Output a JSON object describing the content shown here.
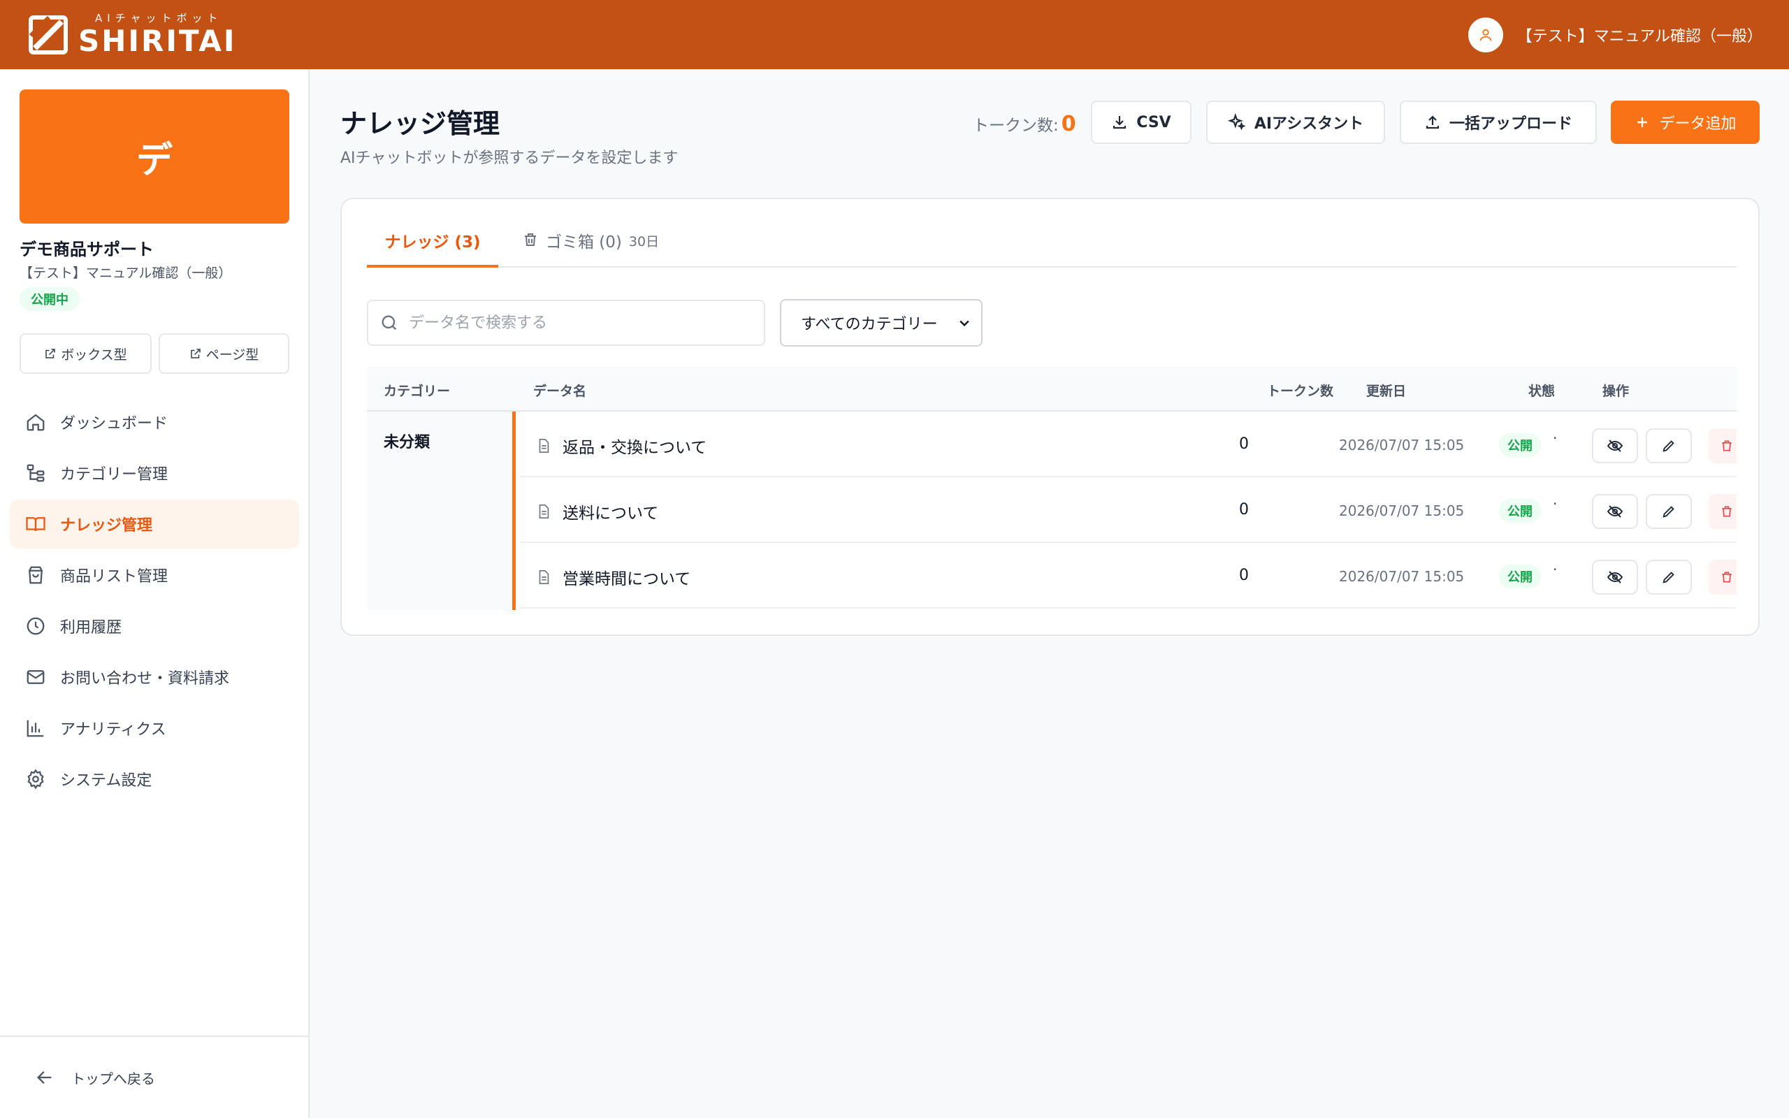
{
  "header": {
    "logo_sub": "AIチャットボット",
    "logo_main": "SHIRITAI",
    "user_name": "【テスト】マニュアル確認（一般）"
  },
  "sidebar": {
    "brand_initial": "デ",
    "brand_name": "デモ商品サポート",
    "brand_owner": "【テスト】マニュアル確認（一般）",
    "status": "公開中",
    "box_link": "ボックス型",
    "page_link": "ページ型",
    "items": [
      {
        "label": "ダッシュボード",
        "icon": "home-icon"
      },
      {
        "label": "カテゴリー管理",
        "icon": "category-tree-icon"
      },
      {
        "label": "ナレッジ管理",
        "icon": "book-icon",
        "active": true
      },
      {
        "label": "商品リスト管理",
        "icon": "shopping-bag-icon"
      },
      {
        "label": "利用履歴",
        "icon": "clock-icon"
      },
      {
        "label": "お問い合わせ・資料請求",
        "icon": "mail-icon"
      },
      {
        "label": "アナリティクス",
        "icon": "bar-chart-icon"
      },
      {
        "label": "システム設定",
        "icon": "gear-icon"
      }
    ],
    "back_label": "トップへ戻る"
  },
  "main": {
    "title": "ナレッジ管理",
    "subtitle": "AIチャットボットが参照するデータを設定します",
    "token_label": "トークン数:",
    "token_value": "0",
    "csv_label": "CSV",
    "assistant_label": "AIアシスタント",
    "bulk_upload_label": "一括アップロード",
    "add_label": "データ追加",
    "tabs": {
      "knowledge": "ナレッジ (3)",
      "trash": "ゴミ箱 (0)",
      "trash_note": "30日"
    },
    "search_placeholder": "データ名で検索する",
    "category_filter": "すべてのカテゴリー",
    "columns": {
      "category": "カテゴリー",
      "name": "データ名",
      "tokens": "トークン数",
      "updated": "更新日",
      "status": "状態",
      "actions": "操作"
    },
    "category_name": "未分類",
    "rows": [
      {
        "name": "返品・交換について",
        "tokens": "0",
        "updated": "2026/07/07 15:05",
        "status": "公開",
        "sep": "·"
      },
      {
        "name": "送料について",
        "tokens": "0",
        "updated": "2026/07/07 15:05",
        "status": "公開",
        "sep": "·"
      },
      {
        "name": "営業時間について",
        "tokens": "0",
        "updated": "2026/07/07 15:05",
        "status": "公開",
        "sep": "·"
      }
    ]
  },
  "colors": {
    "header_bg": "#c25113",
    "accent": "#f97316",
    "active_text": "#ea580c",
    "status_green": "#16a34a"
  }
}
